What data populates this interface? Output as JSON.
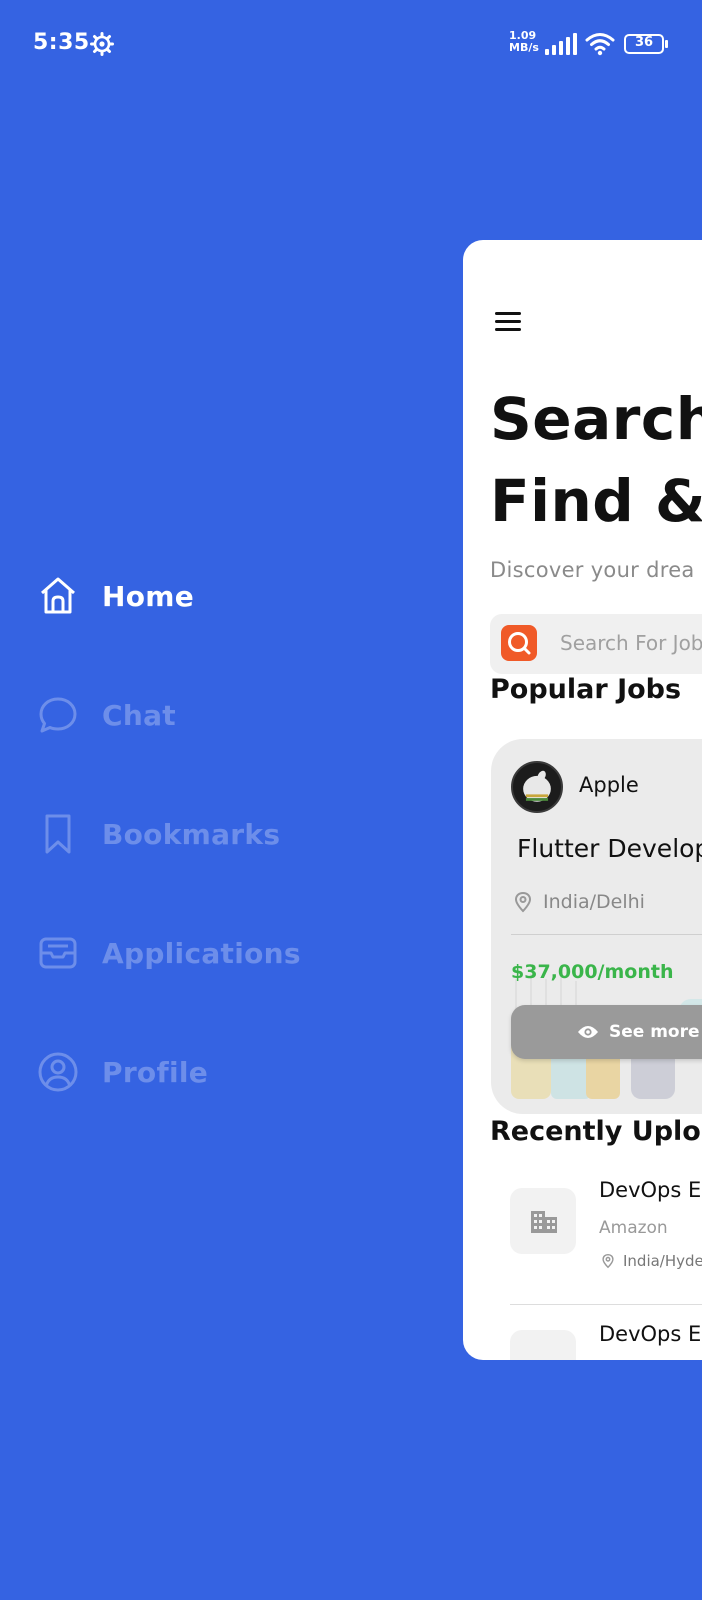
{
  "status_bar": {
    "time": "5:35",
    "net_speed_value": "1.09",
    "net_speed_unit": "MB/s",
    "battery": "36"
  },
  "drawer": {
    "items": [
      {
        "label": "Home",
        "icon": "home-icon",
        "active": true
      },
      {
        "label": "Chat",
        "icon": "chat-icon",
        "active": false
      },
      {
        "label": "Bookmarks",
        "icon": "bookmark-icon",
        "active": false
      },
      {
        "label": "Applications",
        "icon": "inbox-icon",
        "active": false
      },
      {
        "label": "Profile",
        "icon": "profile-icon",
        "active": false
      }
    ]
  },
  "main": {
    "heading_line1": "Search",
    "heading_line2": "Find & A",
    "subtitle": "Discover your drea",
    "search": {
      "placeholder": "Search For Job"
    },
    "popular_title": "Popular Jobs",
    "popular_job": {
      "company": "Apple",
      "title": "Flutter Develop",
      "location": "India/Delhi",
      "salary": "$37,000/month",
      "button_label": "See more d"
    },
    "recent_title": "Recently Uploa",
    "recent_jobs": [
      {
        "title": "DevOps En",
        "company": "Amazon",
        "location": "India/Hyde"
      },
      {
        "title": "DevOps En",
        "company": "",
        "location": ""
      }
    ]
  },
  "colors": {
    "background": "#3563E2",
    "search_accent": "#F05A28",
    "salary": "#3AB54A"
  }
}
